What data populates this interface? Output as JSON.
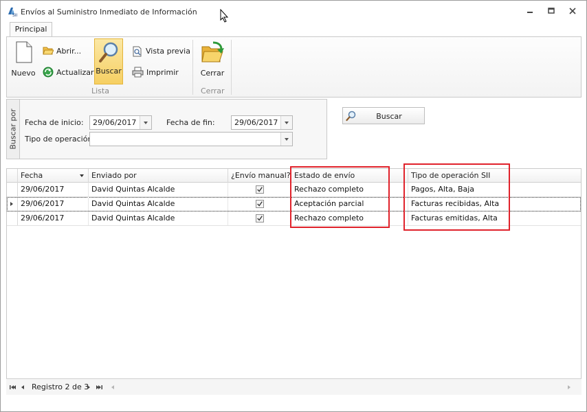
{
  "window": {
    "title": "Envíos al Suministro Inmediato de Información"
  },
  "ribbon": {
    "tabs": [
      {
        "label": "Principal",
        "active": true
      }
    ],
    "groups": {
      "lista": {
        "label": "Lista",
        "nuevo": "Nuevo",
        "abrir": "Abrir...",
        "actualizar": "Actualizar",
        "buscar": "Buscar",
        "vista_previa": "Vista previa",
        "imprimir": "Imprimir"
      },
      "cerrar": {
        "label": "Cerrar",
        "cerrar": "Cerrar"
      }
    }
  },
  "search": {
    "caption": "Buscar por",
    "fecha_inicio_label": "Fecha de inicio:",
    "fecha_inicio_value": "29/06/2017",
    "fecha_fin_label": "Fecha de fin:",
    "fecha_fin_value": "29/06/2017",
    "tipo_operacion_label": "Tipo de operación:",
    "tipo_operacion_value": "",
    "button_label": "Buscar"
  },
  "grid": {
    "columns": [
      "Fecha",
      "Enviado por",
      "¿Envío manual?",
      "Estado de envío",
      "Tipo de operación SII"
    ],
    "rows": [
      {
        "fecha": "29/06/2017",
        "enviado_por": "David Quintas Alcalde",
        "manual": true,
        "estado": "Rechazo completo",
        "tipo": "Pagos, Alta, Baja"
      },
      {
        "fecha": "29/06/2017",
        "enviado_por": "David Quintas Alcalde",
        "manual": true,
        "estado": "Aceptación parcial",
        "tipo": "Facturas recibidas, Alta"
      },
      {
        "fecha": "29/06/2017",
        "enviado_por": "David Quintas Alcalde",
        "manual": true,
        "estado": "Rechazo completo",
        "tipo": "Facturas emitidas, Alta"
      }
    ]
  },
  "navigator": {
    "record_text": "Registro 2 de 3"
  },
  "colors": {
    "highlight": "#e0212a",
    "active_button": "#f6cf62",
    "border": "#c9c9c9"
  }
}
